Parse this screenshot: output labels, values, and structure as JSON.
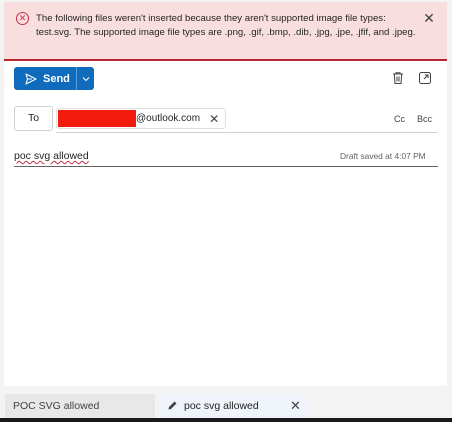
{
  "banner": {
    "message": "The following files weren't inserted because they aren't supported image file types: test.svg. The supported image file types are .png, .gif, .bmp, .dib, .jpg, .jpe, .jfif, and .jpeg.",
    "error_icon": "error-circle-icon",
    "close_icon": "close-icon"
  },
  "toolbar": {
    "send_label": "Send",
    "send_icon": "send-icon",
    "dropdown_icon": "chevron-down-icon",
    "discard_icon": "trash-icon",
    "popout_icon": "popout-icon"
  },
  "to_row": {
    "to_label": "To",
    "recipient_domain": "@outlook.com",
    "remove_icon": "close-icon",
    "cc_label": "Cc",
    "bcc_label": "Bcc"
  },
  "subject_row": {
    "subject_value": "poc svg allowed",
    "draft_status": "Draft saved at 4:07 PM"
  },
  "tabs": [
    {
      "label": "POC SVG allowed"
    },
    {
      "label": "poc svg allowed",
      "icon": "pen-icon",
      "close_icon": "close-icon"
    }
  ],
  "colors": {
    "accent": "#0f6cbd",
    "banner_bg": "#f9dedf",
    "error": "#b4272e",
    "redaction": "#f21b0d"
  }
}
